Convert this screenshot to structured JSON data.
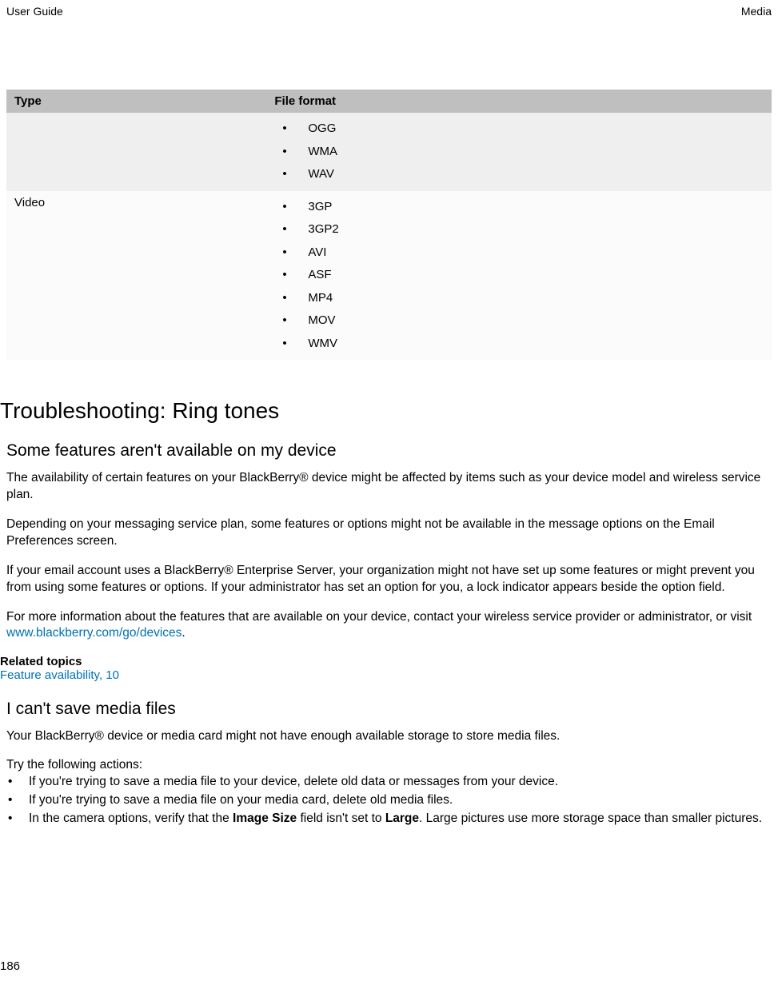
{
  "header": {
    "left": "User Guide",
    "right": "Media"
  },
  "table": {
    "headers": {
      "col1": "Type",
      "col2": "File format"
    },
    "row1": {
      "type": "",
      "formats": [
        "OGG",
        "WMA",
        "WAV"
      ]
    },
    "row2": {
      "type": "Video",
      "formats": [
        "3GP",
        "3GP2",
        "AVI",
        "ASF",
        "MP4",
        "MOV",
        "WMV"
      ]
    }
  },
  "heading1": "Troubleshooting: Ring tones",
  "section1": {
    "title": "Some features aren't available on my device",
    "p1": "The availability of certain features on your BlackBerry® device might be affected by items such as your device model and wireless service plan.",
    "p2": "Depending on your messaging service plan, some features or options might not be available in the message options on the Email Preferences screen.",
    "p3": "If your email account uses a BlackBerry® Enterprise Server, your organization might not have set up some features or might prevent you from using some features or options. If your administrator has set an option for you, a lock indicator appears beside the option field.",
    "p4_pre": "For more information about the features that are available on your device, contact your wireless service provider or administrator, or visit ",
    "p4_link": "www.blackberry.com/go/devices",
    "p4_post": ".",
    "relatedLabel": "Related topics",
    "relatedLink": "Feature availability, 10"
  },
  "section2": {
    "title": "I can't save media files",
    "p1": "Your BlackBerry® device or media card might not have enough available storage to store media files.",
    "intro": "Try the following actions:",
    "items": {
      "a": "If you're trying to save a media file to your device, delete old data or messages from your device.",
      "b": "If you're trying to save a media file on your media card, delete old media files.",
      "c_pre": "In the camera options, verify that the ",
      "c_bold1": "Image Size",
      "c_mid": " field isn't set to ",
      "c_bold2": "Large",
      "c_post": ". Large pictures use more storage space than smaller pictures."
    }
  },
  "pageNumber": "186"
}
